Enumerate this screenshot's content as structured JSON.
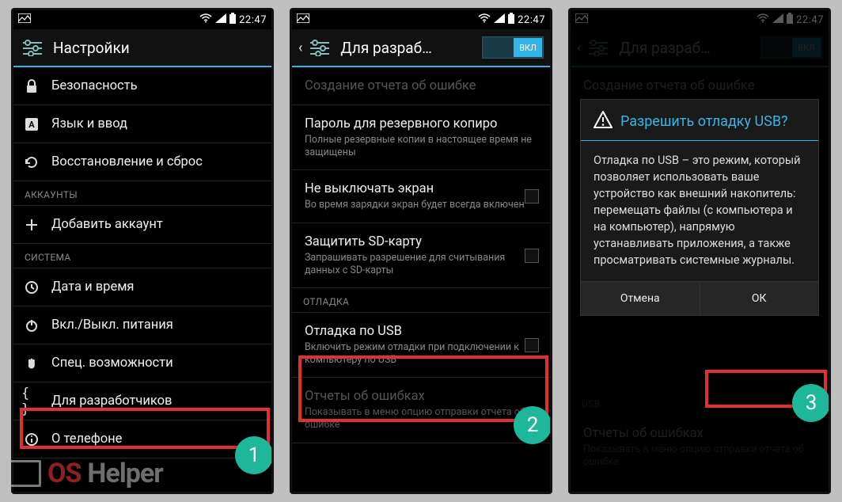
{
  "statusbar": {
    "time": "22:47"
  },
  "screens": [
    {
      "title": "Настройки",
      "items": [
        {
          "icon": "lock-icon",
          "label": "Безопасность"
        },
        {
          "icon": "lang-icon",
          "label": "Язык и ввод"
        },
        {
          "icon": "restore-icon",
          "label": "Восстановление и сброс"
        }
      ],
      "section_accounts": "АККАУНТЫ",
      "add_account": {
        "icon": "plus-icon",
        "label": "Добавить аккаунт"
      },
      "section_system": "СИСТЕМА",
      "system_items": [
        {
          "icon": "clock-icon",
          "label": "Дата и время"
        },
        {
          "icon": "power-icon",
          "label": "Вкл./Выкл. питания"
        },
        {
          "icon": "hand-icon",
          "label": "Спец. возможности"
        },
        {
          "icon": "braces-icon",
          "label": "Для разработчиков"
        },
        {
          "icon": "info-icon",
          "label": "О телефоне"
        }
      ],
      "badge": "1"
    },
    {
      "title": "Для разраб…",
      "toggle_label": "ВКЛ",
      "items": [
        {
          "label": "Создание отчета об ошибке",
          "faded": true
        },
        {
          "label": "Пароль для резервного копиро",
          "sub": "Полные резервные копии в настоящее время не защищены"
        },
        {
          "label": "Не выключать экран",
          "sub": "Во время зарядки экран будет всегда включен",
          "chk": true
        },
        {
          "label": "Защитить SD-карту",
          "sub": "Запрашивать разрешение для считывания данных с SD-карты",
          "chk": true
        }
      ],
      "section_debug": "ОТЛАДКА",
      "debug_items": [
        {
          "label": "Отладка по USB",
          "sub": "Включить режим отладки при подключении к компьютеру по USB",
          "chk": true
        },
        {
          "label": "Отчеты об ошибках",
          "sub": "Показывать в меню опцию отправки отчета об ошибке",
          "faded": true
        }
      ],
      "badge": "2"
    },
    {
      "title": "Для разраб…",
      "toggle_label": "ВКЛ",
      "dialog": {
        "title": "Разрешить отладку USB?",
        "body": "Отладка по USB – это режим, который позволяет использовать ваше устройство как внешний накопитель: перемещать файлы (с компьютера и на компьютер), напрямую устанавливать приложения, а также просматривать системные журналы.",
        "cancel": "Отмена",
        "ok": "ОК"
      },
      "bg_items": [
        {
          "label": "Создание отчета об ошибке"
        }
      ],
      "bg_section_debug": "USB",
      "bg_debug_items": [
        {
          "label": "Отчеты об ошибках",
          "sub": "Показывать в меню опцию отправки отчета об ошибке"
        }
      ],
      "badge": "3"
    }
  ],
  "watermark": {
    "part1": "OS",
    "part2": "Helper"
  }
}
